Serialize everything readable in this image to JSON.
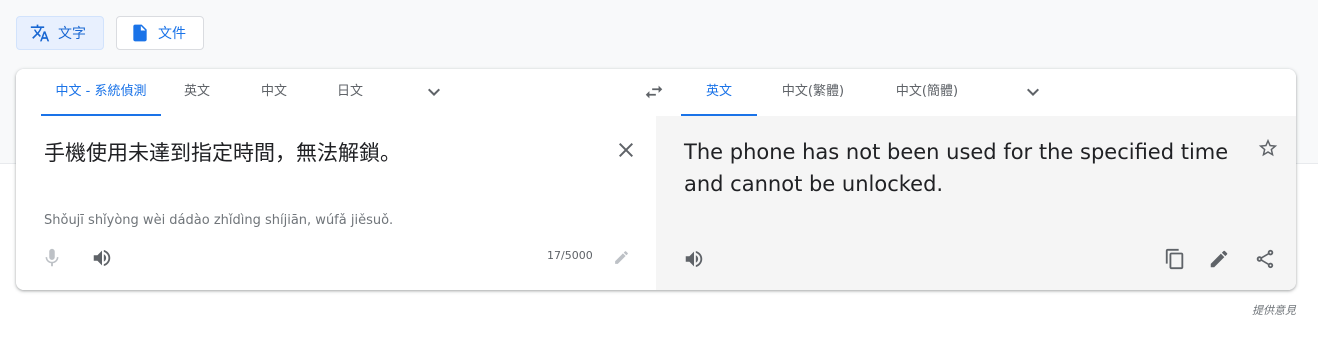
{
  "mode_buttons": [
    {
      "label": "文字",
      "icon": "translate-icon",
      "active": true
    },
    {
      "label": "文件",
      "icon": "document-icon",
      "active": false
    }
  ],
  "source_languages": [
    "中文 - 系統偵測",
    "英文",
    "中文",
    "日文"
  ],
  "target_languages": [
    "英文",
    "中文(繁體)",
    "中文(簡體)"
  ],
  "source": {
    "text": "手機使用未達到指定時間，無法解鎖。",
    "romanization": "Shǒujī shǐyòng wèi dádào zhǐdìng shíjiān, wúfǎ jiěsuǒ.",
    "char_count": "17/5000"
  },
  "target": {
    "text": "The phone has not been used for the specified time and cannot be unlocked."
  },
  "feedback_label": "提供意見",
  "colors": {
    "accent": "#1a73e8",
    "target_panel_bg": "#f5f5f5",
    "icon_gray": "#5f6368",
    "disabled_gray": "#bdc1c6"
  }
}
